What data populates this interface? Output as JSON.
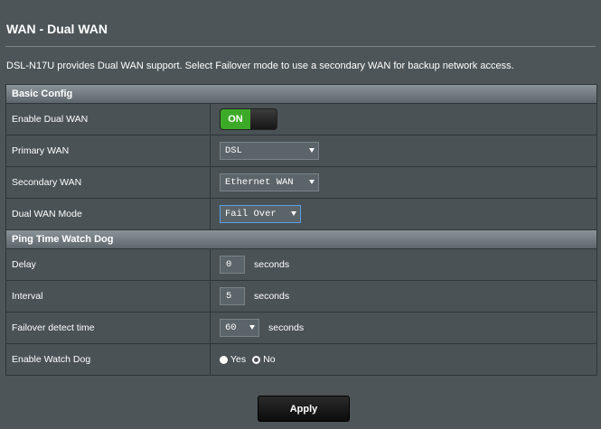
{
  "page": {
    "title": "WAN - Dual WAN",
    "description": "DSL-N17U provides Dual WAN support. Select Failover mode to use a secondary WAN for backup network access."
  },
  "basic_config": {
    "heading": "Basic Config",
    "enable_dual_wan": {
      "label": "Enable Dual WAN",
      "toggle_text": "ON",
      "enabled": true
    },
    "primary_wan": {
      "label": "Primary WAN",
      "value": "DSL"
    },
    "secondary_wan": {
      "label": "Secondary WAN",
      "value": "Ethernet WAN"
    },
    "dual_wan_mode": {
      "label": "Dual WAN Mode",
      "value": "Fail Over"
    }
  },
  "watch_dog": {
    "heading": "Ping Time Watch Dog",
    "delay": {
      "label": "Delay",
      "value": "0",
      "unit": "seconds"
    },
    "interval": {
      "label": "Interval",
      "value": "5",
      "unit": "seconds"
    },
    "failover_detect_time": {
      "label": "Failover detect time",
      "value": "60",
      "unit": "seconds"
    },
    "enable_watch_dog": {
      "label": "Enable Watch Dog",
      "yes_label": "Yes",
      "no_label": "No",
      "selected": "Yes"
    }
  },
  "actions": {
    "apply_label": "Apply"
  },
  "colors": {
    "toggle_on": "#3caa28",
    "background": "#4d5558",
    "focus_border": "#5aa0e8"
  }
}
